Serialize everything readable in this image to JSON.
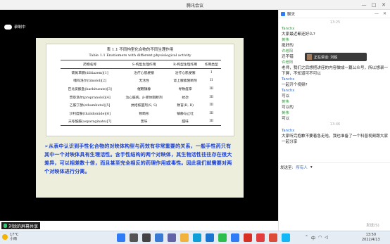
{
  "window": {
    "title": "腾讯会议",
    "controls": [
      "—",
      "□",
      "✕"
    ]
  },
  "recording": {
    "label": "录制中"
  },
  "slide": {
    "table_title_cn": "表 1.1  不同构型化合物的不同生理作用",
    "table_title_en": "Table 1.1 Enatiomers with different physiological activity",
    "headers": [
      "药物名称",
      "S-构型生理作用",
      "R-构型生理作用",
      "作用类型"
    ],
    "rows": [
      [
        "硫氮草酮(diltiazem)[1]",
        "治疗心肌梗塞",
        "治疗心肌梗塞",
        "I"
      ],
      [
        "噻吗洛尔(timolol)[2]",
        "无活性",
        "肾上腺素阻断剂",
        "II"
      ],
      [
        "巴比妥酸盐(barbiturate)[3]",
        "催眠镇静",
        "导致痉挛",
        "III"
      ],
      [
        "普萘洛尔(propranolol)[4]",
        "治心脏病、β-受体阻断剂",
        "抗孕",
        "III"
      ],
      [
        "乙胺丁醇(ethambutol)[5]",
        "抗结核菌剂(S, S)",
        "致盲(R, R)",
        "III"
      ],
      [
        "沙利度胺(thalidomide)[6]",
        "致畸形",
        "镇静与止吐",
        "III"
      ],
      [
        "天冬酰胺(asparaginate)[7]",
        "苦味",
        "甜味",
        "III"
      ]
    ],
    "paragraph": "➢从表中认识到手性化合物的对映体构型与药效有非常重要的关系，一般手性药只有其中一个对映体具有生理活性。含手性结构的两个对映体，其生物活性往往存在很大差异，可以相差数十倍，而且甚至完全相反的药理作用或毒性。因此我们就需要对两个对映体进行分离。"
  },
  "screen_share": {
    "label": "刘锐的屏幕共享"
  },
  "chat": {
    "title": "聊天",
    "messages": [
      {
        "type": "time",
        "text": "13:25"
      },
      {
        "type": "msg",
        "name": "Tanchx",
        "name_color": "green",
        "text": "大家最近都还好么?"
      },
      {
        "type": "msg",
        "name": "黄伟",
        "name_color": "green",
        "text": "挺好的"
      },
      {
        "type": "msg",
        "name": "许增阳",
        "name_color": "green",
        "text": "还不错"
      },
      {
        "type": "msg",
        "name": "许增阳",
        "name_color": "green",
        "text": "老师，我们之后想把讲座的内容做成一篇公众号，所以想录一下屏，不知道可不可以"
      },
      {
        "type": "msg",
        "name": "Tanchx",
        "name_color": "blue",
        "text": "一起开个视频?"
      },
      {
        "type": "msg",
        "name": "Tanchx",
        "name_color": "blue",
        "text": "可以"
      },
      {
        "type": "msg",
        "name": "黄伟",
        "name_color": "green",
        "text": "可以的"
      },
      {
        "type": "msg",
        "name": "黄伟",
        "name_color": "green",
        "text": "可以"
      },
      {
        "type": "time",
        "text": "13:46"
      },
      {
        "type": "msg",
        "name": "Tanchx",
        "name_color": "blue",
        "text": "大家听完抱歉不要着急走哈，我也准备了一个科普视频跟大家一起分享"
      }
    ],
    "popup": "正在讲话: 刘锐",
    "send_to_label": "发送至:",
    "send_to_value": "所有人",
    "send_button": "发送(S)"
  },
  "taskbar": {
    "weather_temp": "17°C",
    "weather_desc": "小雨",
    "time": "13:50",
    "date": "2022/4/13",
    "lang": "中",
    "icons": [
      {
        "name": "windows-start-icon",
        "color": "#2f7cf6"
      },
      {
        "name": "search-icon",
        "color": "#555555"
      },
      {
        "name": "task-view-icon",
        "color": "#444444"
      },
      {
        "name": "widgets-icon",
        "color": "#3a7bd5"
      },
      {
        "name": "chat-teams-icon",
        "color": "#6264a7"
      },
      {
        "name": "file-explorer-icon",
        "color": "#f2b33d"
      },
      {
        "name": "edge-browser-icon",
        "color": "#0f9fd8"
      },
      {
        "name": "store-icon",
        "color": "#1a75d1"
      },
      {
        "name": "wechat-icon",
        "color": "#2dbe4f"
      },
      {
        "name": "tencent-meeting-icon",
        "color": "#2f7cf6"
      },
      {
        "name": "pdf-reader-icon",
        "color": "#d93025"
      },
      {
        "name": "wps-icon",
        "color": "#e43d3d"
      },
      {
        "name": "chrome-icon",
        "color": "#dd4b39"
      },
      {
        "name": "qq-icon",
        "color": "#12b7f5"
      }
    ]
  }
}
